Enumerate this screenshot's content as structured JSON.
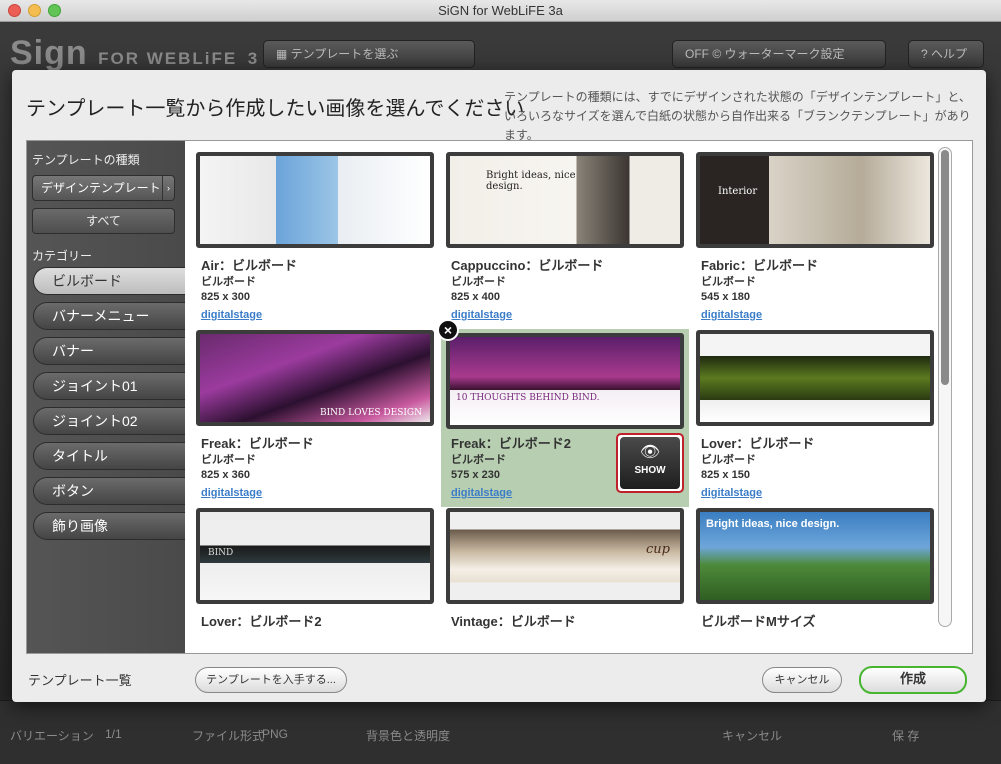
{
  "window": {
    "title": "SiGN for WebLiFE 3a"
  },
  "background_app": {
    "logo": "Sign",
    "logo_suffix": "FOR WEBLiFE",
    "logo_version": "3",
    "template_select_label": "テンプレートを選ぶ",
    "watermark_toggle": "OFF",
    "watermark_label": "ウォーターマーク設定",
    "help_label": "ヘルプ",
    "variation_label": "バリエーション",
    "variation_value": "1/1",
    "file_format_label": "ファイル形式",
    "file_format_value": "PNG",
    "bg_transparency_label": "背景色と透明度",
    "cancel_label": "キャンセル",
    "save_label": "保 存"
  },
  "dialog": {
    "title": "テンプレート一覧から作成したい画像を選んでください",
    "description": "テンプレートの種類には、すでにデザインされた状態の「デザインテンプレート」と、いろいろなサイズを選んで白紙の状態から自作出来る「ブランクテンプレート」があります。",
    "sidebar": {
      "type_heading": "テンプレートの種類",
      "type_selected": "デザインテンプレート",
      "all_button": "すべて",
      "category_heading": "カテゴリー",
      "categories": [
        "ビルボード",
        "バナーメニュー",
        "バナー",
        "ジョイント01",
        "ジョイント02",
        "タイトル",
        "ボタン",
        "飾り画像"
      ]
    },
    "templates": [
      {
        "name": "Air：ビルボード",
        "category": "ビルボード",
        "size": "825 x 300",
        "author": "digitalstage"
      },
      {
        "name": "Cappuccino：ビルボード",
        "category": "ビルボード",
        "size": "825 x 400",
        "author": "digitalstage",
        "thumb_text": "Bright ideas, nice design."
      },
      {
        "name": "Fabric：ビルボード",
        "category": "ビルボード",
        "size": "545 x 180",
        "author": "digitalstage",
        "thumb_text": "Interior"
      },
      {
        "name": "Freak：ビルボード",
        "category": "ビルボード",
        "size": "825 x 360",
        "author": "digitalstage",
        "thumb_text": "BIND LOVES DESIGN"
      },
      {
        "name": "Freak：ビルボード2",
        "category": "ビルボード",
        "size": "575 x 230",
        "author": "digitalstage",
        "thumb_text": "10 THOUGHTS BEHIND BIND."
      },
      {
        "name": "Lover：ビルボード",
        "category": "ビルボード",
        "size": "825 x 150",
        "author": "digitalstage"
      },
      {
        "name": "Lover：ビルボード2",
        "thumb_text": "BIND"
      },
      {
        "name": "Vintage：ビルボード",
        "thumb_text": "cup"
      },
      {
        "name": "ビルボードMサイズ",
        "thumb_text": "Bright ideas, nice design."
      }
    ],
    "show_button": "SHOW",
    "footer": {
      "label": "テンプレート一覧",
      "get_templates": "テンプレートを入手する...",
      "cancel": "キャンセル",
      "create": "作成"
    }
  }
}
